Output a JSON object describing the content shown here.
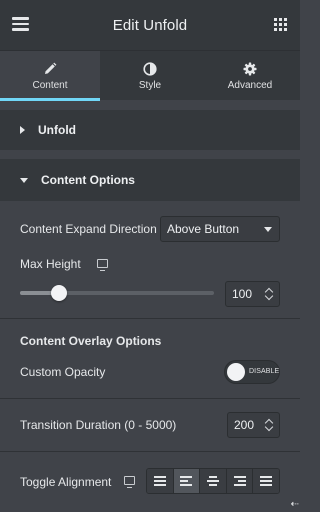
{
  "header": {
    "title": "Edit Unfold",
    "menu_icon": "hamburger-menu-icon",
    "apps_icon": "grid-apps-icon"
  },
  "tabs": [
    {
      "label": "Content",
      "icon": "pencil-icon",
      "active": true
    },
    {
      "label": "Style",
      "icon": "half-circle-icon",
      "active": false
    },
    {
      "label": "Advanced",
      "icon": "gear-icon",
      "active": false
    }
  ],
  "sections": {
    "unfold": {
      "label": "Unfold",
      "expanded": false
    },
    "content_options": {
      "label": "Content Options",
      "expanded": true
    }
  },
  "controls": {
    "expand_direction": {
      "label": "Content Expand Direction",
      "value": "Above Button"
    },
    "max_height": {
      "label": "Max Height",
      "value": "100",
      "slider_fraction": 0.2
    },
    "overlay_heading": "Content Overlay Options",
    "custom_opacity": {
      "label": "Custom Opacity",
      "toggle_text": "DISABLE",
      "enabled": false
    },
    "transition_duration": {
      "label": "Transition Duration (0 - 5000)",
      "value": "200"
    },
    "toggle_alignment": {
      "label": "Toggle Alignment",
      "options": [
        "justify-icon",
        "align-left-icon",
        "align-center-icon",
        "align-right-icon",
        "justify-full-icon"
      ],
      "selected_index": 1
    }
  },
  "colors": {
    "panel_bg": "#404349",
    "header_bg": "#34383c",
    "accent": "#71d7f7"
  },
  "misc": {
    "corner_arrow": "⇠"
  }
}
